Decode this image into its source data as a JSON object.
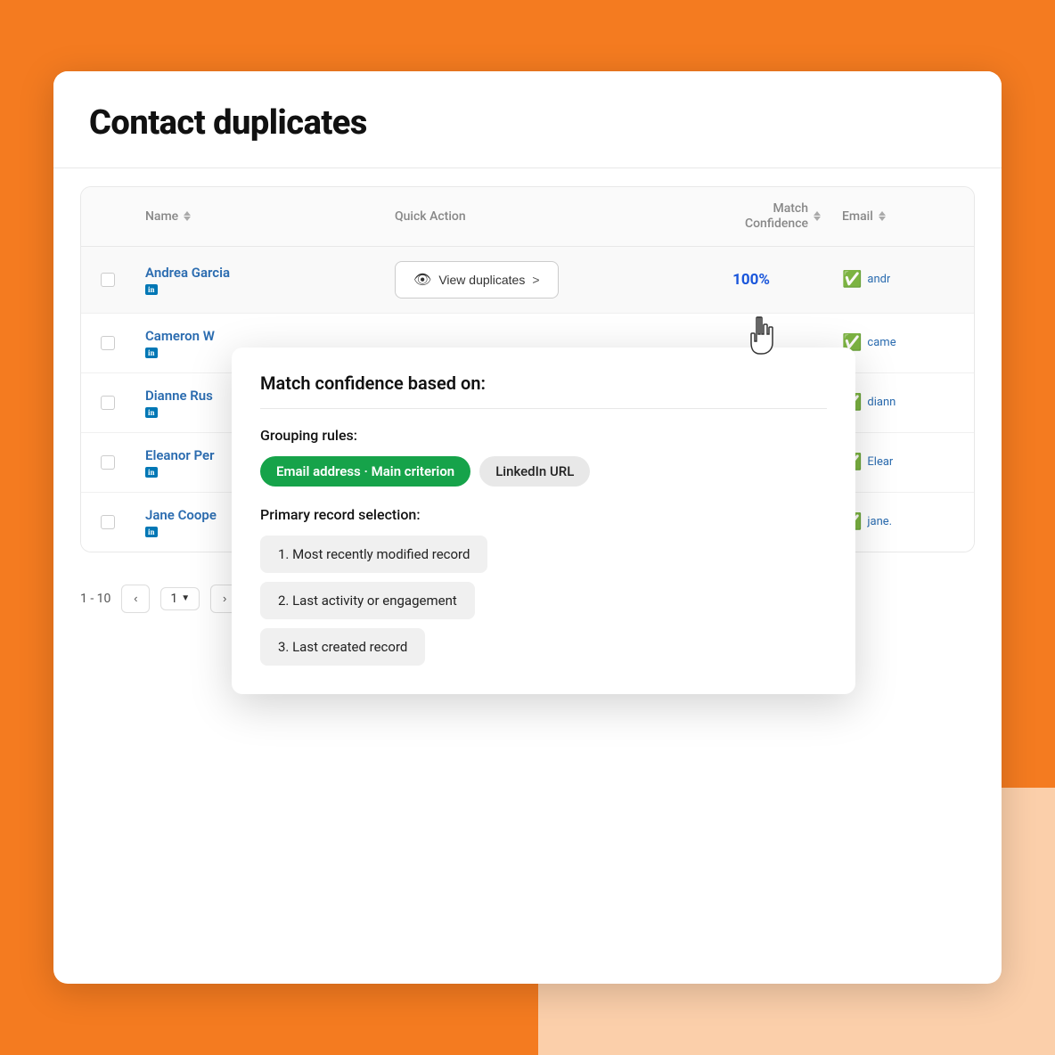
{
  "page": {
    "title": "Contact duplicates",
    "background_color": "#F47B20"
  },
  "table": {
    "columns": [
      {
        "id": "checkbox",
        "label": ""
      },
      {
        "id": "name",
        "label": "Name"
      },
      {
        "id": "quick_action",
        "label": "Quick Action"
      },
      {
        "id": "match_confidence",
        "label": "Match Confidence"
      },
      {
        "id": "email",
        "label": "Email"
      }
    ],
    "rows": [
      {
        "name": "Andrea Garcia",
        "linkedin": "in",
        "quick_action": "View duplicates",
        "match_confidence": "100%",
        "email": "andr",
        "email_verified": true
      },
      {
        "name": "Cameron W",
        "linkedin": "in",
        "quick_action": "",
        "match_confidence": "",
        "email": "came",
        "email_verified": true
      },
      {
        "name": "Dianne Rus",
        "linkedin": "in",
        "quick_action": "",
        "match_confidence": "",
        "email": "diann",
        "email_verified": true
      },
      {
        "name": "Eleanor Per",
        "linkedin": "in",
        "quick_action": "",
        "match_confidence": "",
        "email": "Elear",
        "email_verified": true
      },
      {
        "name": "Jane Coope",
        "linkedin": "in",
        "quick_action": "",
        "match_confidence": "",
        "email": "jane.",
        "email_verified": true
      }
    ]
  },
  "pagination": {
    "range": "1 - 10",
    "current_page": "1"
  },
  "popover": {
    "title": "Match confidence based on:",
    "grouping_rules_label": "Grouping rules:",
    "tags": [
      {
        "label": "Email address · Main criterion",
        "style": "green"
      },
      {
        "label": "LinkedIn URL",
        "style": "gray"
      }
    ],
    "primary_record_label": "Primary record selection:",
    "record_items": [
      "1.  Most recently modified record",
      "2.  Last activity or engagement",
      "3.  Last created record"
    ]
  },
  "buttons": {
    "view_duplicates": "View duplicates",
    "prev_page": "‹",
    "next_page": "›"
  },
  "icons": {
    "sort": "⇅",
    "eye": "👁",
    "chevron_right": ">",
    "email_verified": "✓",
    "dropdown": "▼"
  }
}
